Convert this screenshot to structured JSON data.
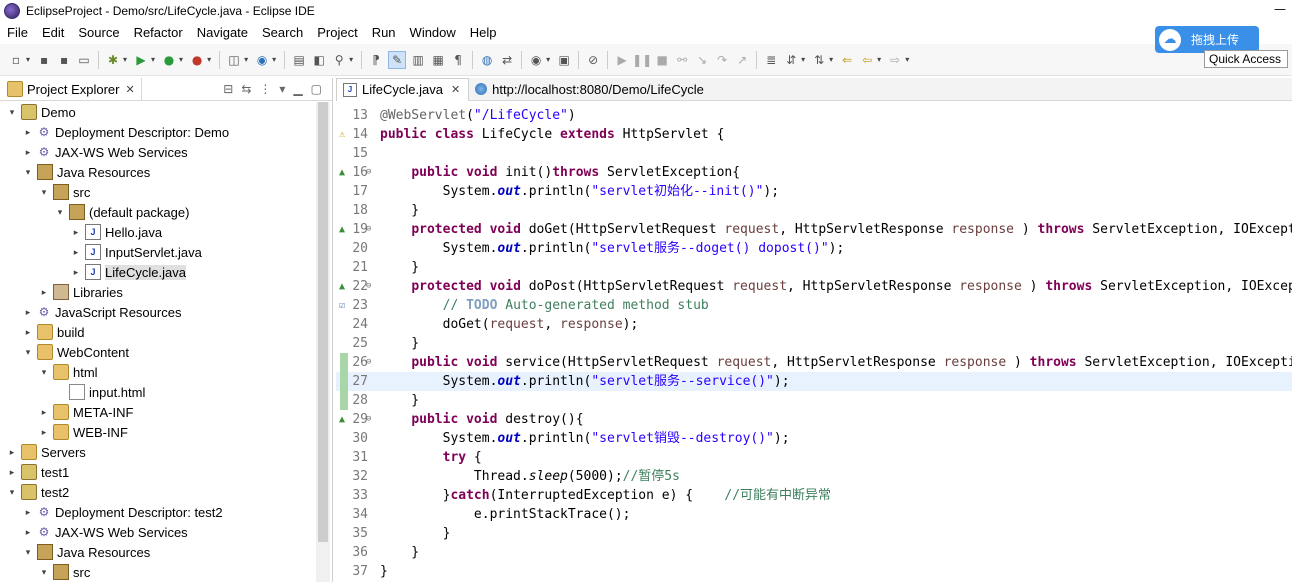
{
  "window": {
    "title": "EclipseProject - Demo/src/LifeCycle.java - Eclipse IDE"
  },
  "menu": [
    "File",
    "Edit",
    "Source",
    "Refactor",
    "Navigate",
    "Search",
    "Project",
    "Run",
    "Window",
    "Help"
  ],
  "quick_access": "Quick Access",
  "baidu_upload": "拖拽上传",
  "explorer": {
    "tab_label": "Project Explorer",
    "items": [
      {
        "depth": 0,
        "expanded": true,
        "icon": "project-icon",
        "label": "Demo"
      },
      {
        "depth": 1,
        "expanded": false,
        "icon": "gear-icon",
        "label": "Deployment Descriptor: Demo"
      },
      {
        "depth": 1,
        "expanded": false,
        "icon": "gear-icon",
        "label": "JAX-WS Web Services"
      },
      {
        "depth": 1,
        "expanded": true,
        "icon": "java-resources-icon",
        "label": "Java Resources"
      },
      {
        "depth": 2,
        "expanded": true,
        "icon": "source-folder-icon",
        "label": "src"
      },
      {
        "depth": 3,
        "expanded": true,
        "icon": "package-icon",
        "label": "(default package)"
      },
      {
        "depth": 4,
        "expanded": false,
        "icon": "java-file-icon",
        "label": "Hello.java"
      },
      {
        "depth": 4,
        "expanded": false,
        "icon": "java-file-icon",
        "label": "InputServlet.java"
      },
      {
        "depth": 4,
        "expanded": false,
        "icon": "java-file-icon",
        "label": "LifeCycle.java",
        "selected": true
      },
      {
        "depth": 2,
        "expanded": false,
        "icon": "library-icon",
        "label": "Libraries"
      },
      {
        "depth": 1,
        "expanded": false,
        "icon": "gear-icon",
        "label": "JavaScript Resources"
      },
      {
        "depth": 1,
        "expanded": false,
        "icon": "folder-icon",
        "label": "build"
      },
      {
        "depth": 1,
        "expanded": true,
        "icon": "folder-icon",
        "label": "WebContent"
      },
      {
        "depth": 2,
        "expanded": true,
        "icon": "folder-icon",
        "label": "html"
      },
      {
        "depth": 3,
        "leaf": true,
        "icon": "file-icon",
        "label": "input.html"
      },
      {
        "depth": 2,
        "expanded": false,
        "icon": "folder-icon",
        "label": "META-INF"
      },
      {
        "depth": 2,
        "expanded": false,
        "icon": "folder-icon",
        "label": "WEB-INF"
      },
      {
        "depth": 0,
        "expanded": false,
        "icon": "folder-icon",
        "label": "Servers"
      },
      {
        "depth": 0,
        "expanded": false,
        "icon": "project-icon",
        "label": "test1"
      },
      {
        "depth": 0,
        "expanded": true,
        "icon": "project-icon",
        "label": "test2"
      },
      {
        "depth": 1,
        "expanded": false,
        "icon": "gear-icon",
        "label": "Deployment Descriptor: test2"
      },
      {
        "depth": 1,
        "expanded": false,
        "icon": "gear-icon",
        "label": "JAX-WS Web Services"
      },
      {
        "depth": 1,
        "expanded": true,
        "icon": "java-resources-icon",
        "label": "Java Resources"
      },
      {
        "depth": 2,
        "expanded": true,
        "icon": "source-folder-icon",
        "label": "src"
      }
    ]
  },
  "editor": {
    "tabs": [
      {
        "label": "LifeCycle.java",
        "active": true,
        "icon": "java-file-icon"
      },
      {
        "label": "http://localhost:8080/Demo/LifeCycle",
        "active": false,
        "icon": "globe-icon"
      }
    ],
    "lines": [
      {
        "n": "13",
        "fold": "",
        "mark": "",
        "tokens": [
          [
            "ann",
            "@WebServlet"
          ],
          [
            "",
            "("
          ],
          [
            "str",
            "\"/LifeCycle\""
          ],
          [
            "",
            ")"
          ]
        ]
      },
      {
        "n": "14",
        "fold": "",
        "mark": "warn",
        "tokens": [
          [
            "kw",
            "public"
          ],
          [
            "",
            " "
          ],
          [
            "kw",
            "class"
          ],
          [
            "",
            " LifeCycle "
          ],
          [
            "kw",
            "extends"
          ],
          [
            "",
            " HttpServlet {"
          ]
        ]
      },
      {
        "n": "15",
        "fold": "",
        "mark": "",
        "tokens": []
      },
      {
        "n": "16",
        "fold": "⊖",
        "mark": "override",
        "tokens": [
          [
            "",
            "    "
          ],
          [
            "kw",
            "public"
          ],
          [
            "",
            " "
          ],
          [
            "kw",
            "void"
          ],
          [
            "",
            " init()"
          ],
          [
            "kw",
            "throws"
          ],
          [
            "",
            " ServletException{"
          ]
        ]
      },
      {
        "n": "17",
        "fold": "",
        "mark": "",
        "tokens": [
          [
            "",
            "        System."
          ],
          [
            "fld",
            "out"
          ],
          [
            "",
            ".println("
          ],
          [
            "str",
            "\"servlet初始化--init()\""
          ],
          [
            "",
            ");"
          ]
        ]
      },
      {
        "n": "18",
        "fold": "",
        "mark": "",
        "tokens": [
          [
            "",
            "    }"
          ]
        ]
      },
      {
        "n": "19",
        "fold": "⊖",
        "mark": "override",
        "tokens": [
          [
            "",
            "    "
          ],
          [
            "kw",
            "protected"
          ],
          [
            "",
            " "
          ],
          [
            "kw",
            "void"
          ],
          [
            "",
            " doGet(HttpServletRequest "
          ],
          [
            "param",
            "request"
          ],
          [
            "",
            ", HttpServletResponse "
          ],
          [
            "param",
            "response"
          ],
          [
            "",
            " ) "
          ],
          [
            "kw",
            "throws"
          ],
          [
            "",
            " ServletException, IOException {"
          ]
        ]
      },
      {
        "n": "20",
        "fold": "",
        "mark": "",
        "tokens": [
          [
            "",
            "        System."
          ],
          [
            "fld",
            "out"
          ],
          [
            "",
            ".println("
          ],
          [
            "str",
            "\"servlet服务--doget() dopost()\""
          ],
          [
            "",
            ");"
          ]
        ]
      },
      {
        "n": "21",
        "fold": "",
        "mark": "",
        "tokens": [
          [
            "",
            "    }"
          ]
        ]
      },
      {
        "n": "22",
        "fold": "⊖",
        "mark": "override",
        "tokens": [
          [
            "",
            "    "
          ],
          [
            "kw",
            "protected"
          ],
          [
            "",
            " "
          ],
          [
            "kw",
            "void"
          ],
          [
            "",
            " doPost(HttpServletRequest "
          ],
          [
            "param",
            "request"
          ],
          [
            "",
            ", HttpServletResponse "
          ],
          [
            "param",
            "response"
          ],
          [
            "",
            " ) "
          ],
          [
            "kw",
            "throws"
          ],
          [
            "",
            " ServletException, IOException {"
          ]
        ]
      },
      {
        "n": "23",
        "fold": "",
        "mark": "task",
        "tokens": [
          [
            "",
            "        "
          ],
          [
            "cm",
            "// "
          ],
          [
            "todo",
            "TODO"
          ],
          [
            "cm",
            " Auto-generated method stub"
          ]
        ]
      },
      {
        "n": "24",
        "fold": "",
        "mark": "",
        "tokens": [
          [
            "",
            "        doGet("
          ],
          [
            "param",
            "request"
          ],
          [
            "",
            ", "
          ],
          [
            "param",
            "response"
          ],
          [
            "",
            ");"
          ]
        ]
      },
      {
        "n": "25",
        "fold": "",
        "mark": "",
        "tokens": [
          [
            "",
            "    }"
          ]
        ]
      },
      {
        "n": "26",
        "fold": "⊖",
        "mark": "change",
        "tokens": [
          [
            "",
            "    "
          ],
          [
            "kw",
            "public"
          ],
          [
            "",
            " "
          ],
          [
            "kw",
            "void"
          ],
          [
            "",
            " service(HttpServletRequest "
          ],
          [
            "param",
            "request"
          ],
          [
            "",
            ", HttpServletResponse "
          ],
          [
            "param",
            "response"
          ],
          [
            "",
            " ) "
          ],
          [
            "kw",
            "throws"
          ],
          [
            "",
            " ServletException, IOException {"
          ]
        ]
      },
      {
        "n": "27",
        "fold": "",
        "mark": "change",
        "current": true,
        "tokens": [
          [
            "",
            "        System."
          ],
          [
            "fld",
            "out"
          ],
          [
            "",
            ".println("
          ],
          [
            "str",
            "\"servlet服务--service()\""
          ],
          [
            "",
            ");"
          ]
        ]
      },
      {
        "n": "28",
        "fold": "",
        "mark": "change",
        "tokens": [
          [
            "",
            "    }"
          ]
        ]
      },
      {
        "n": "29",
        "fold": "⊖",
        "mark": "override",
        "tokens": [
          [
            "",
            "    "
          ],
          [
            "kw",
            "public"
          ],
          [
            "",
            " "
          ],
          [
            "kw",
            "void"
          ],
          [
            "",
            " destroy(){"
          ]
        ]
      },
      {
        "n": "30",
        "fold": "",
        "mark": "",
        "tokens": [
          [
            "",
            "        System."
          ],
          [
            "fld",
            "out"
          ],
          [
            "",
            ".println("
          ],
          [
            "str",
            "\"servlet销毁--destroy()\""
          ],
          [
            "",
            ");"
          ]
        ]
      },
      {
        "n": "31",
        "fold": "",
        "mark": "",
        "tokens": [
          [
            "",
            "        "
          ],
          [
            "kw",
            "try"
          ],
          [
            "",
            " {"
          ]
        ]
      },
      {
        "n": "32",
        "fold": "",
        "mark": "",
        "tokens": [
          [
            "",
            "            Thread."
          ],
          [
            "sta",
            "sleep"
          ],
          [
            "",
            "(5000);"
          ],
          [
            "cm",
            "//暂停5s"
          ]
        ]
      },
      {
        "n": "33",
        "fold": "",
        "mark": "",
        "tokens": [
          [
            "",
            "        }"
          ],
          [
            "kw",
            "catch"
          ],
          [
            "",
            "(InterruptedException e) {    "
          ],
          [
            "cm",
            "//可能有中断异常"
          ]
        ]
      },
      {
        "n": "34",
        "fold": "",
        "mark": "",
        "tokens": [
          [
            "",
            "            e.printStackTrace();"
          ]
        ]
      },
      {
        "n": "35",
        "fold": "",
        "mark": "",
        "tokens": [
          [
            "",
            "        }"
          ]
        ]
      },
      {
        "n": "36",
        "fold": "",
        "mark": "",
        "tokens": [
          [
            "",
            "    }"
          ]
        ]
      },
      {
        "n": "37",
        "fold": "",
        "mark": "",
        "tokens": [
          [
            "",
            "}"
          ]
        ]
      }
    ]
  }
}
